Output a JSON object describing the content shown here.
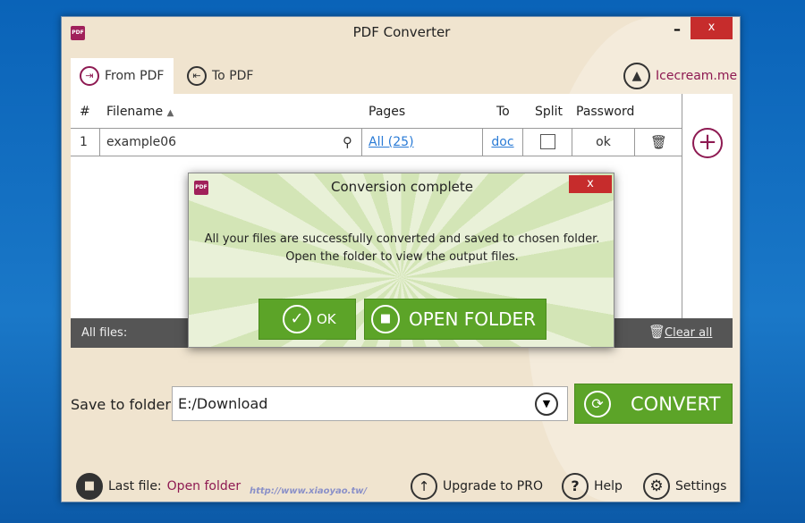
{
  "window": {
    "title": "PDF Converter",
    "minimize": "–",
    "close": "x",
    "logo": "PDF"
  },
  "tabs": [
    {
      "label": "From PDF",
      "active": true
    },
    {
      "label": "To PDF",
      "active": false
    }
  ],
  "brand": "Icecream.me",
  "table": {
    "headers": [
      "#",
      "Filename",
      "Pages",
      "To",
      "Split",
      "Password"
    ],
    "rows": [
      {
        "num": "1",
        "filename": "example06",
        "pages": "All (25)",
        "to": "doc",
        "split": false,
        "password": "ok"
      }
    ]
  },
  "bottom_bar": {
    "all_files": "All files:",
    "clear_all": "Clear all"
  },
  "dialog": {
    "title": "Conversion complete",
    "close": "x",
    "line1": "All your files are successfully converted and saved to chosen folder.",
    "line2": "Open the folder to view the output files.",
    "ok": "OK",
    "open_folder": "OPEN FOLDER"
  },
  "save": {
    "label": "Save to folder:",
    "value": "E:/Download",
    "convert": "CONVERT"
  },
  "footer": {
    "last_file": "Last file:",
    "open_folder": "Open folder",
    "upgrade": "Upgrade to PRO",
    "help": "Help",
    "settings": "Settings"
  },
  "watermark": {
    "text": "http://www.xiaoyao.tw/"
  },
  "colors": {
    "accent": "#8e1a52",
    "green": "#5ca428",
    "close_red": "#c62c2c",
    "link": "#2a7bd6"
  }
}
